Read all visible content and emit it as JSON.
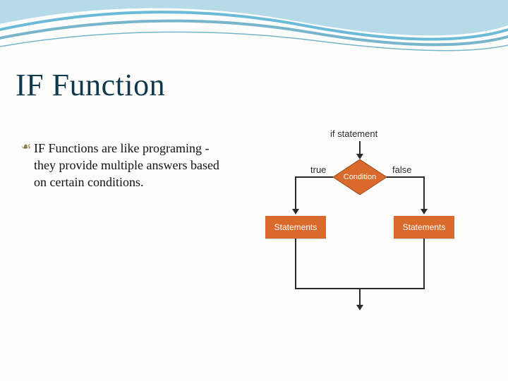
{
  "title": "IF Function",
  "bullet": {
    "text": "IF Functions are like programing - they provide multiple answers based on certain conditions."
  },
  "diagram": {
    "top_label": "if statement",
    "condition": "Condition",
    "true_label": "true",
    "false_label": "false",
    "left_box": "Statements",
    "right_box": "Statements"
  },
  "colors": {
    "accent": "#d96a2b",
    "title": "#11394e"
  }
}
